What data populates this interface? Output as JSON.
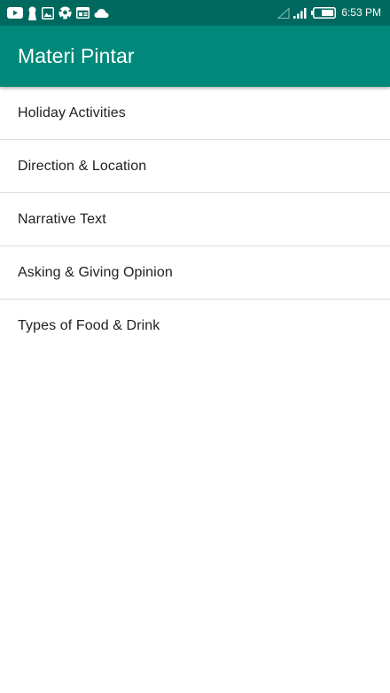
{
  "status_bar": {
    "time": "6:53 PM",
    "notification_icons": [
      "youtube-icon",
      "keyhole-icon",
      "image-icon",
      "soccer-ball-icon",
      "browser-window-icon",
      "cloud-icon"
    ],
    "system_icons": [
      "signal-empty-icon",
      "signal-icon",
      "battery-icon"
    ],
    "background_color": "#00695f"
  },
  "app_bar": {
    "title": "Materi Pintar",
    "background_color": "#00897b"
  },
  "materials": {
    "items": [
      {
        "label": "Holiday Activities"
      },
      {
        "label": "Direction & Location"
      },
      {
        "label": "Narrative Text"
      },
      {
        "label": "Asking & Giving Opinion"
      },
      {
        "label": "Types of Food & Drink"
      }
    ]
  }
}
